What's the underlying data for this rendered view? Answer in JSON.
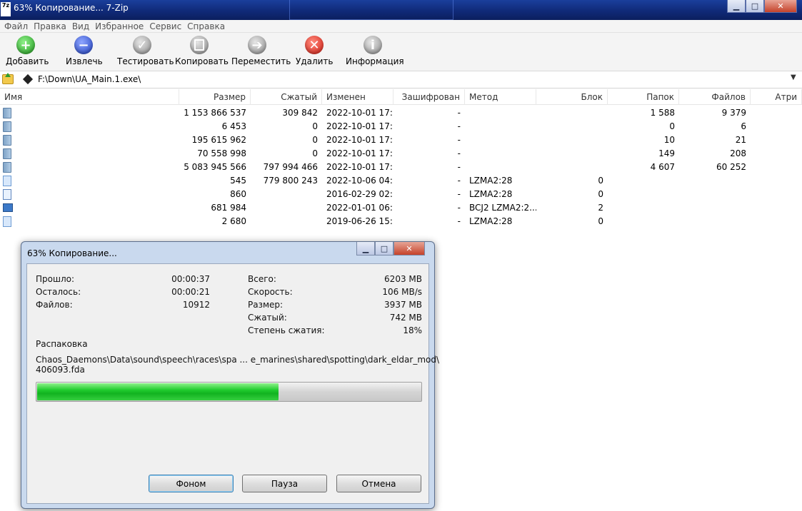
{
  "window": {
    "title": "63% Копирование... 7-Zip",
    "app_icon_text": "7z",
    "minimize_glyph": "▁",
    "maximize_glyph": "□",
    "close_glyph": "✕"
  },
  "menu": [
    "Файл",
    "Правка",
    "Вид",
    "Избранное",
    "Сервис",
    "Справка"
  ],
  "toolbar": {
    "buttons": [
      {
        "label": "Добавить",
        "icon": "add-icon",
        "glyph": "+"
      },
      {
        "label": "Извлечь",
        "icon": "extract-icon",
        "glyph": "−"
      },
      {
        "label": "Тестировать",
        "icon": "test-icon",
        "glyph": "✓"
      },
      {
        "label": "Копировать",
        "icon": "copy-icon",
        "glyph": ""
      },
      {
        "label": "Переместить",
        "icon": "move-icon",
        "glyph": "➔"
      },
      {
        "label": "Удалить",
        "icon": "delete-icon",
        "glyph": "✕"
      },
      {
        "label": "Информация",
        "icon": "info-icon",
        "glyph": "i"
      }
    ]
  },
  "address": {
    "path": "F:\\Down\\UA_Main.1.exe\\",
    "dropdown_glyph": "▼"
  },
  "columns": [
    "Имя",
    "Размер",
    "Сжатый",
    "Изменен",
    "Зашифрован",
    "Метод",
    "Блок",
    "Папок",
    "Файлов",
    "Атри"
  ],
  "rows": [
    {
      "icon": "folder",
      "size": "1 153 866 537",
      "packed": "309 842",
      "modified": "2022-10-01 17:...",
      "encrypted": "-",
      "method": "",
      "block": "",
      "folders": "1 588",
      "files": "9 379"
    },
    {
      "icon": "folder",
      "size": "6 453",
      "packed": "0",
      "modified": "2022-10-01 17:...",
      "encrypted": "-",
      "method": "",
      "block": "",
      "folders": "0",
      "files": "6"
    },
    {
      "icon": "folder",
      "size": "195 615 962",
      "packed": "0",
      "modified": "2022-10-01 17:...",
      "encrypted": "-",
      "method": "",
      "block": "",
      "folders": "10",
      "files": "21"
    },
    {
      "icon": "folder",
      "size": "70 558 998",
      "packed": "0",
      "modified": "2022-10-01 17:...",
      "encrypted": "-",
      "method": "",
      "block": "",
      "folders": "149",
      "files": "208"
    },
    {
      "icon": "folder",
      "size": "5 083 945 566",
      "packed": "797 994 466",
      "modified": "2022-10-01 17:...",
      "encrypted": "-",
      "method": "",
      "block": "",
      "folders": "4 607",
      "files": "60 252"
    },
    {
      "icon": "file",
      "size": "545",
      "packed": "779 800 243",
      "modified": "2022-10-06 04:...",
      "encrypted": "-",
      "method": "LZMA2:28",
      "block": "0",
      "folders": "",
      "files": ""
    },
    {
      "icon": "doc",
      "size": "860",
      "packed": "",
      "modified": "2016-02-29 02:...",
      "encrypted": "-",
      "method": "LZMA2:28",
      "block": "0",
      "folders": "",
      "files": ""
    },
    {
      "icon": "exe",
      "size": "681 984",
      "packed": "",
      "modified": "2022-01-01 06:...",
      "encrypted": "-",
      "method": "BCJ2 LZMA2:2...",
      "block": "2",
      "folders": "",
      "files": ""
    },
    {
      "icon": "file",
      "size": "2 680",
      "packed": "",
      "modified": "2019-06-26 15:...",
      "encrypted": "-",
      "method": "LZMA2:28",
      "block": "0",
      "folders": "",
      "files": ""
    }
  ],
  "dialog": {
    "title": "63% Копирование...",
    "left": [
      {
        "label": "Прошло:",
        "value": "00:00:37"
      },
      {
        "label": "Осталось:",
        "value": "00:00:21"
      },
      {
        "label": "Файлов:",
        "value": "10912"
      }
    ],
    "right": [
      {
        "label": "Всего:",
        "value": "6203 MB"
      },
      {
        "label": "Скорость:",
        "value": "106 MB/s"
      },
      {
        "label": "Размер:",
        "value": "3937 MB"
      },
      {
        "label": "Сжатый:",
        "value": "742 MB"
      },
      {
        "label": "Степень сжатия:",
        "value": "18%"
      }
    ],
    "operation": "Распаковка",
    "path_line1": "Chaos_Daemons\\Data\\sound\\speech\\races\\spa ... e_marines\\shared\\spotting\\dark_eldar_mod\\",
    "path_line2": "406093.fda",
    "progress_percent": 63,
    "buttons": {
      "background": "Фоном",
      "pause": "Пауза",
      "cancel": "Отмена"
    },
    "minimize_glyph": "▁",
    "maximize_glyph": "□",
    "close_glyph": "✕"
  },
  "colors": {
    "progress_fill": "#1fcb2d",
    "title_bar": "#102a78"
  }
}
